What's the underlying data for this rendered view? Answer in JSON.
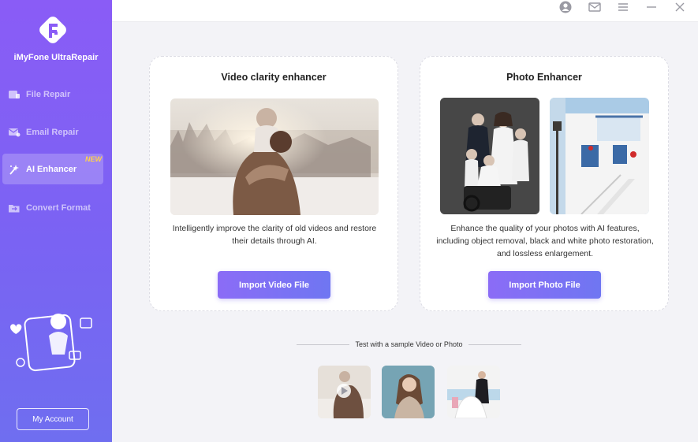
{
  "app": {
    "name": "iMyFone UltraRepair"
  },
  "sidebar": {
    "items": [
      {
        "label": "File Repair",
        "icon": "file-repair-icon",
        "active": false
      },
      {
        "label": "Email Repair",
        "icon": "email-repair-icon",
        "active": false
      },
      {
        "label": "AI Enhancer",
        "icon": "ai-enhancer-icon",
        "active": true,
        "badge": "NEW"
      },
      {
        "label": "Convert Format",
        "icon": "convert-format-icon",
        "active": false
      }
    ],
    "account_label": "My Account"
  },
  "titlebar": {
    "icons": [
      "account-icon",
      "mail-icon",
      "menu-icon",
      "minimize-icon",
      "close-icon"
    ]
  },
  "video_card": {
    "title": "Video clarity enhancer",
    "description": "Intelligently improve the clarity of old videos and restore their details through AI.",
    "button_label": "Import Video File"
  },
  "photo_card": {
    "title": "Photo Enhancer",
    "description": "Enhance the quality of your photos with AI features, including object removal, black and white photo restoration, and lossless enlargement.",
    "button_label": "Import Photo File"
  },
  "samples": {
    "title": "Test with a sample Video or Photo"
  },
  "colors": {
    "accent": "#7b63f3",
    "badge": "#ffd24a"
  }
}
